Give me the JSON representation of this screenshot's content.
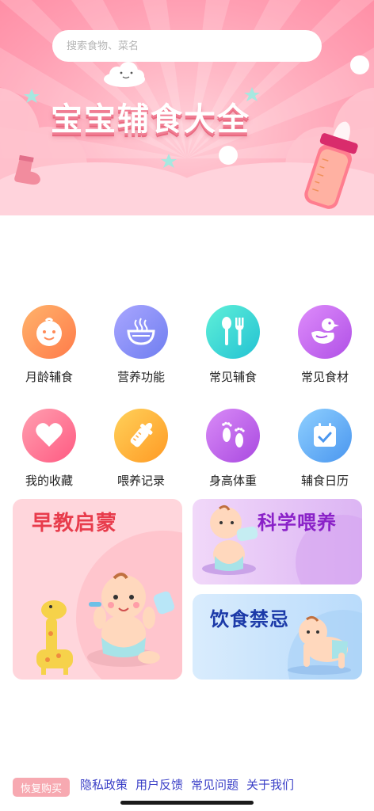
{
  "search": {
    "placeholder": "搜索食物、菜名"
  },
  "banner": {
    "title": "宝宝辅食大全"
  },
  "features": [
    {
      "label": "月龄辅食",
      "icon": "baby-face-icon",
      "color": "#ff8a57"
    },
    {
      "label": "营养功能",
      "icon": "bowl-icon",
      "color": "#8e8cf3"
    },
    {
      "label": "常见辅食",
      "icon": "spoon-fork-icon",
      "color": "#2fd4cf"
    },
    {
      "label": "常见食材",
      "icon": "duck-icon",
      "color": "#c46af0"
    },
    {
      "label": "我的收藏",
      "icon": "heart-icon",
      "color": "#ff6f8f"
    },
    {
      "label": "喂养记录",
      "icon": "baby-bottle-icon",
      "color": "#ffb13b"
    },
    {
      "label": "身高体重",
      "icon": "footprints-icon",
      "color": "#c064ec"
    },
    {
      "label": "辅食日历",
      "icon": "calendar-icon",
      "color": "#4fa8f5"
    }
  ],
  "cards": {
    "early_education": "早教启蒙",
    "scientific_feeding": "科学喂养",
    "diet_taboo": "饮食禁忌"
  },
  "footer": {
    "restore": "恢复购买",
    "privacy": "隐私政策",
    "feedback": "用户反馈",
    "faq": "常见问题",
    "about": "关于我们"
  }
}
